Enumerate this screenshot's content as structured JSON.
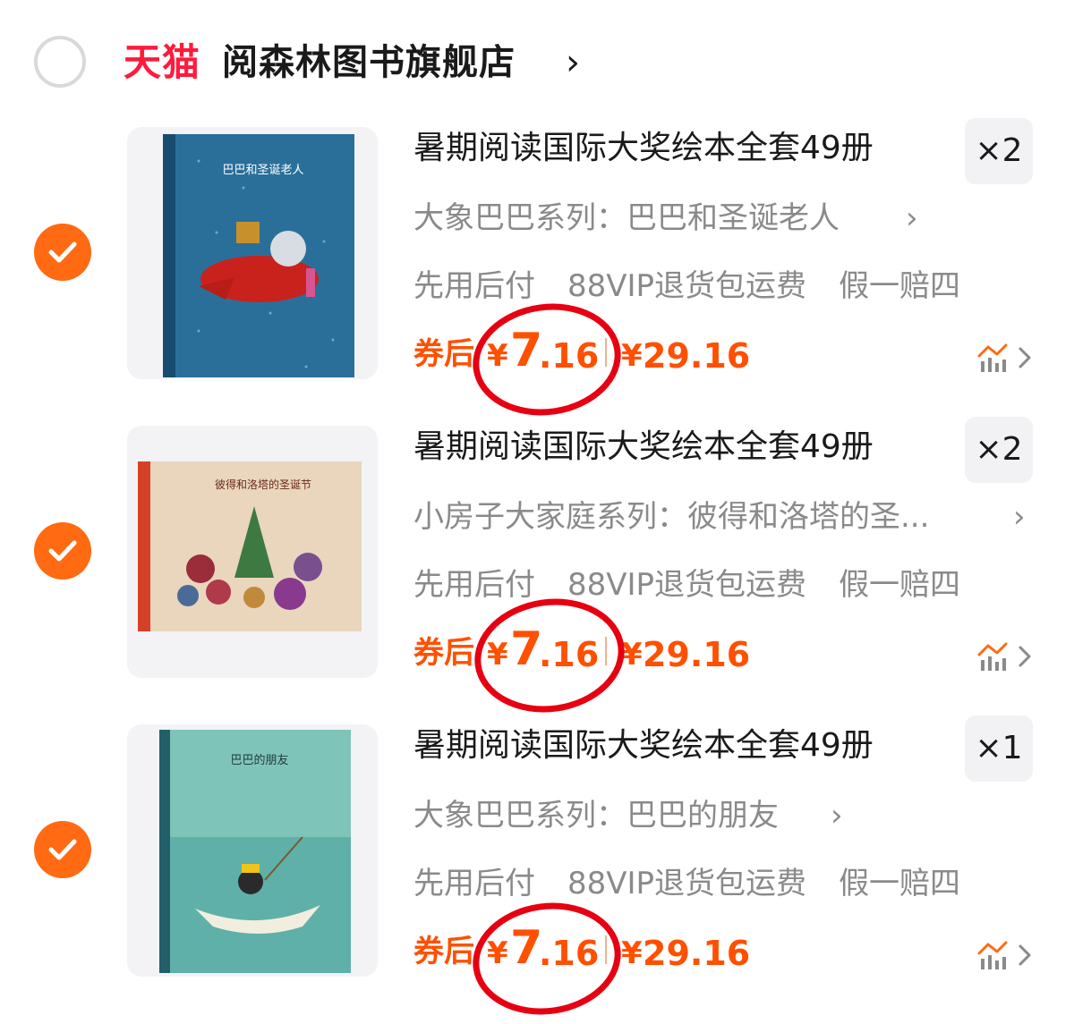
{
  "store": {
    "logo_text": "天猫",
    "name": "阅森林图书旗舰店",
    "chevron": "›"
  },
  "colors": {
    "accent": "#ff5000",
    "check": "#ff6a13",
    "tmall": "#ff1a3c",
    "annotation": "#e60012"
  },
  "items": [
    {
      "title": "暑期阅读国际大奖绘本全套49册",
      "quantity": "×2",
      "variant": "大象巴巴系列：巴巴和圣诞老人",
      "variant_chevron": "›",
      "services": [
        "先用后付",
        "88VIP退货包运费",
        "假一赔四"
      ],
      "coupon_label": "券后",
      "currency": "¥",
      "price_int": "7",
      "price_dec": ".16",
      "orig_currency": "¥",
      "orig_price": "29.16",
      "cover_title": "巴巴和圣诞老人",
      "selected": true
    },
    {
      "title": "暑期阅读国际大奖绘本全套49册",
      "quantity": "×2",
      "variant": "小房子大家庭系列：彼得和洛塔的圣...",
      "variant_chevron": "›",
      "services": [
        "先用后付",
        "88VIP退货包运费",
        "假一赔四"
      ],
      "coupon_label": "券后",
      "currency": "¥",
      "price_int": "7",
      "price_dec": ".16",
      "orig_currency": "¥",
      "orig_price": "29.16",
      "cover_title": "彼得和洛塔的圣诞节",
      "selected": true
    },
    {
      "title": "暑期阅读国际大奖绘本全套49册",
      "quantity": "×1",
      "variant": "大象巴巴系列：巴巴的朋友",
      "variant_chevron": "›",
      "services": [
        "先用后付",
        "88VIP退货包运费",
        "假一赔四"
      ],
      "coupon_label": "券后",
      "currency": "¥",
      "price_int": "7",
      "price_dec": ".16",
      "orig_currency": "¥",
      "orig_price": "29.16",
      "cover_title": "巴巴的朋友",
      "selected": true
    }
  ],
  "icons": {
    "store_radio": "radio-unchecked-icon",
    "item_check": "checkmark-circle-icon",
    "trend": "price-trend-icon"
  }
}
